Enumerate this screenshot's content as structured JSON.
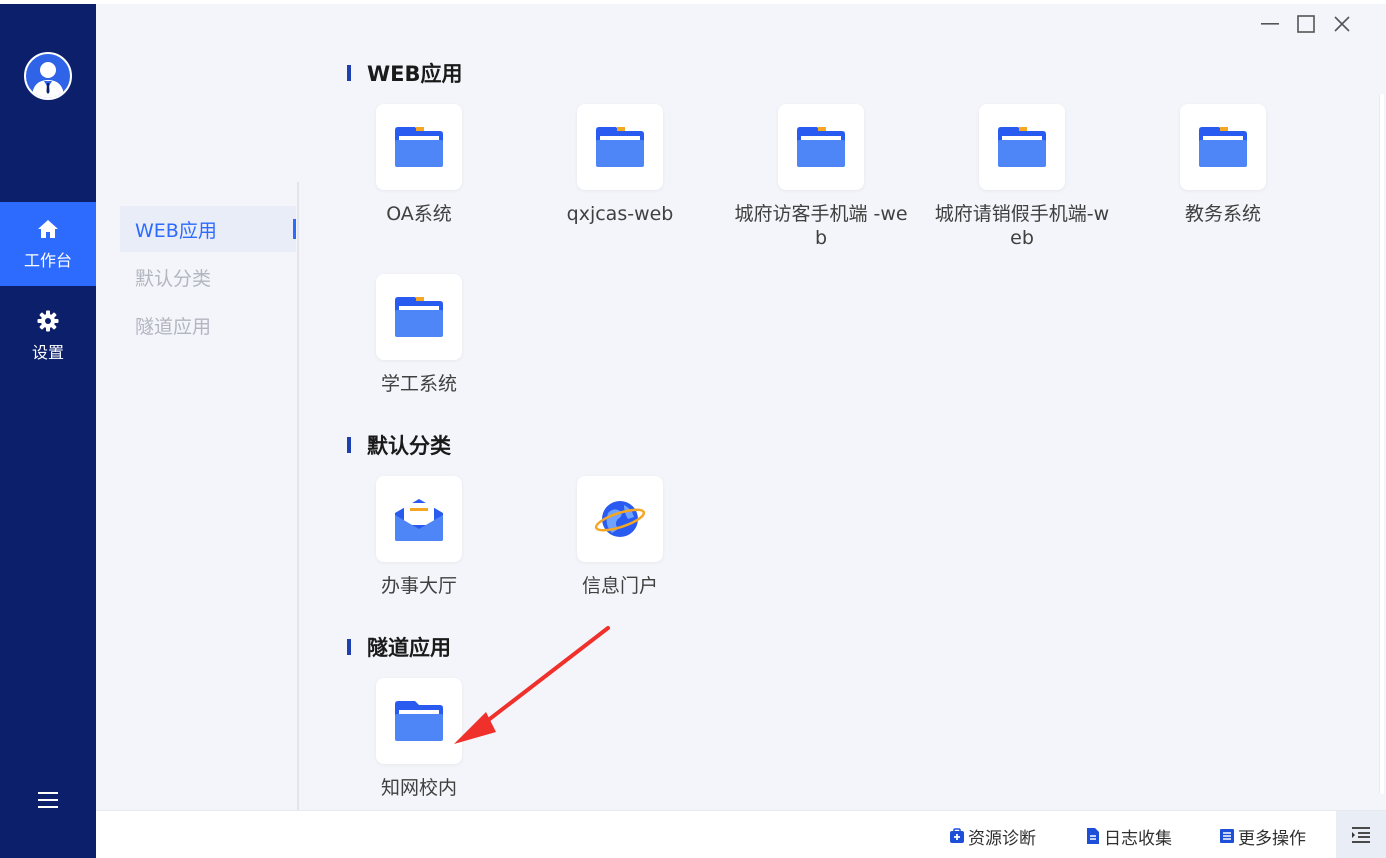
{
  "sidebar": {
    "nav": [
      {
        "label": "工作台",
        "icon": "home-icon",
        "active": true
      },
      {
        "label": "设置",
        "icon": "gear-icon",
        "active": false
      }
    ],
    "menu_icon": "menu-icon"
  },
  "categories": [
    {
      "label": "WEB应用",
      "active": true
    },
    {
      "label": "默认分类",
      "active": false
    },
    {
      "label": "隧道应用",
      "active": false
    }
  ],
  "sections": [
    {
      "title": "WEB应用",
      "apps": [
        {
          "name": "OA系统",
          "icon": "folder-icon"
        },
        {
          "name": "qxjcas-web",
          "icon": "folder-icon"
        },
        {
          "name": "城府访客手机端 -web",
          "icon": "folder-icon"
        },
        {
          "name": "城府请销假手机端-web",
          "icon": "folder-icon"
        },
        {
          "name": "教务系统",
          "icon": "folder-icon"
        },
        {
          "name": "学工系统",
          "icon": "folder-icon"
        }
      ]
    },
    {
      "title": "默认分类",
      "apps": [
        {
          "name": "办事大厅",
          "icon": "mail-icon"
        },
        {
          "name": "信息门户",
          "icon": "globe-icon"
        }
      ]
    },
    {
      "title": "隧道应用",
      "apps": [
        {
          "name": "知网校内",
          "icon": "folder-icon"
        }
      ]
    }
  ],
  "footer": {
    "diagnose": "资源诊断",
    "logs": "日志收集",
    "more": "更多操作"
  },
  "colors": {
    "sidebar": "#0c1f6b",
    "accent": "#2d6bff",
    "annotation_arrow": "#f0302a"
  }
}
